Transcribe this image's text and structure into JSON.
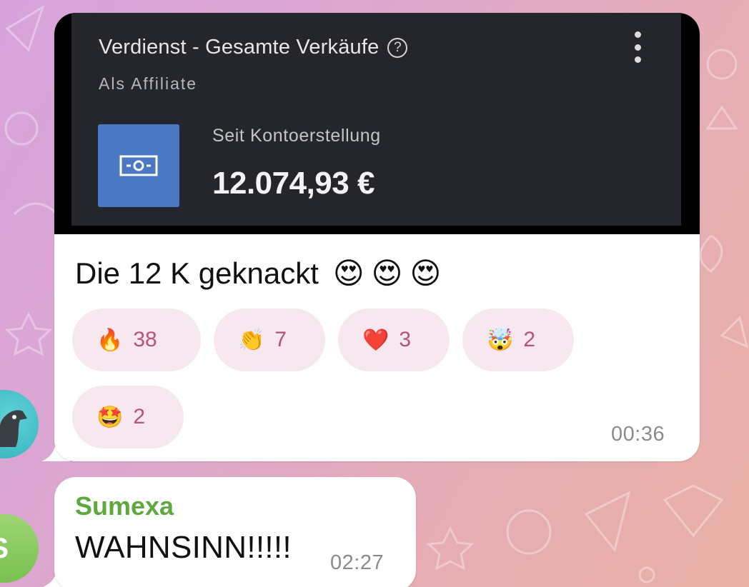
{
  "message_1": {
    "card": {
      "title": "Verdienst - Gesamte Verkäufe",
      "subtitle": "Als Affiliate",
      "since_label": "Seit Kontoerstellung",
      "amount": "12.074,93 €",
      "help_icon": "question-circle-icon",
      "menu_icon": "kebab-menu-icon",
      "tile_icon": "banknote-icon",
      "tile_color": "#4a78c2"
    },
    "caption": "Die 12 K geknackt",
    "caption_emojis": [
      "😍",
      "😍",
      "😍"
    ],
    "reactions": [
      {
        "emoji": "🔥",
        "count": "38"
      },
      {
        "emoji": "👏",
        "count": "7"
      },
      {
        "emoji": "❤️",
        "count": "3"
      },
      {
        "emoji": "🤯",
        "count": "2"
      },
      {
        "emoji": "🤩",
        "count": "2"
      }
    ],
    "time": "00:36"
  },
  "message_2": {
    "sender": "Sumexa",
    "text": "WAHNSINN!!!!!",
    "time": "02:27",
    "sender_color": "#5ea840"
  },
  "avatars": {
    "first": "horse-avatar-icon",
    "second_letter": "S"
  }
}
